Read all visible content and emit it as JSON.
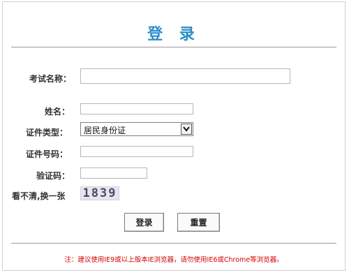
{
  "title": "登 录",
  "form": {
    "exam_name_label": "考试名称：",
    "exam_name_value": "",
    "name_label": "姓名：",
    "name_value": "",
    "id_type_label": "证件类型：",
    "id_type_value": "居民身份证",
    "id_number_label": "证件号码：",
    "id_number_value": "",
    "captcha_label": "验证码：",
    "captcha_value": "",
    "refresh_label": "看不清,换一张",
    "captcha_image_text": "1839"
  },
  "buttons": {
    "login": "登录",
    "reset": "重置"
  },
  "note": "注：建议使用IE9或以上版本IE浏览器，请勿使用IE6或Chrome等浏览器。",
  "colors": {
    "title": "#2a8fc8",
    "note": "#d40000"
  }
}
